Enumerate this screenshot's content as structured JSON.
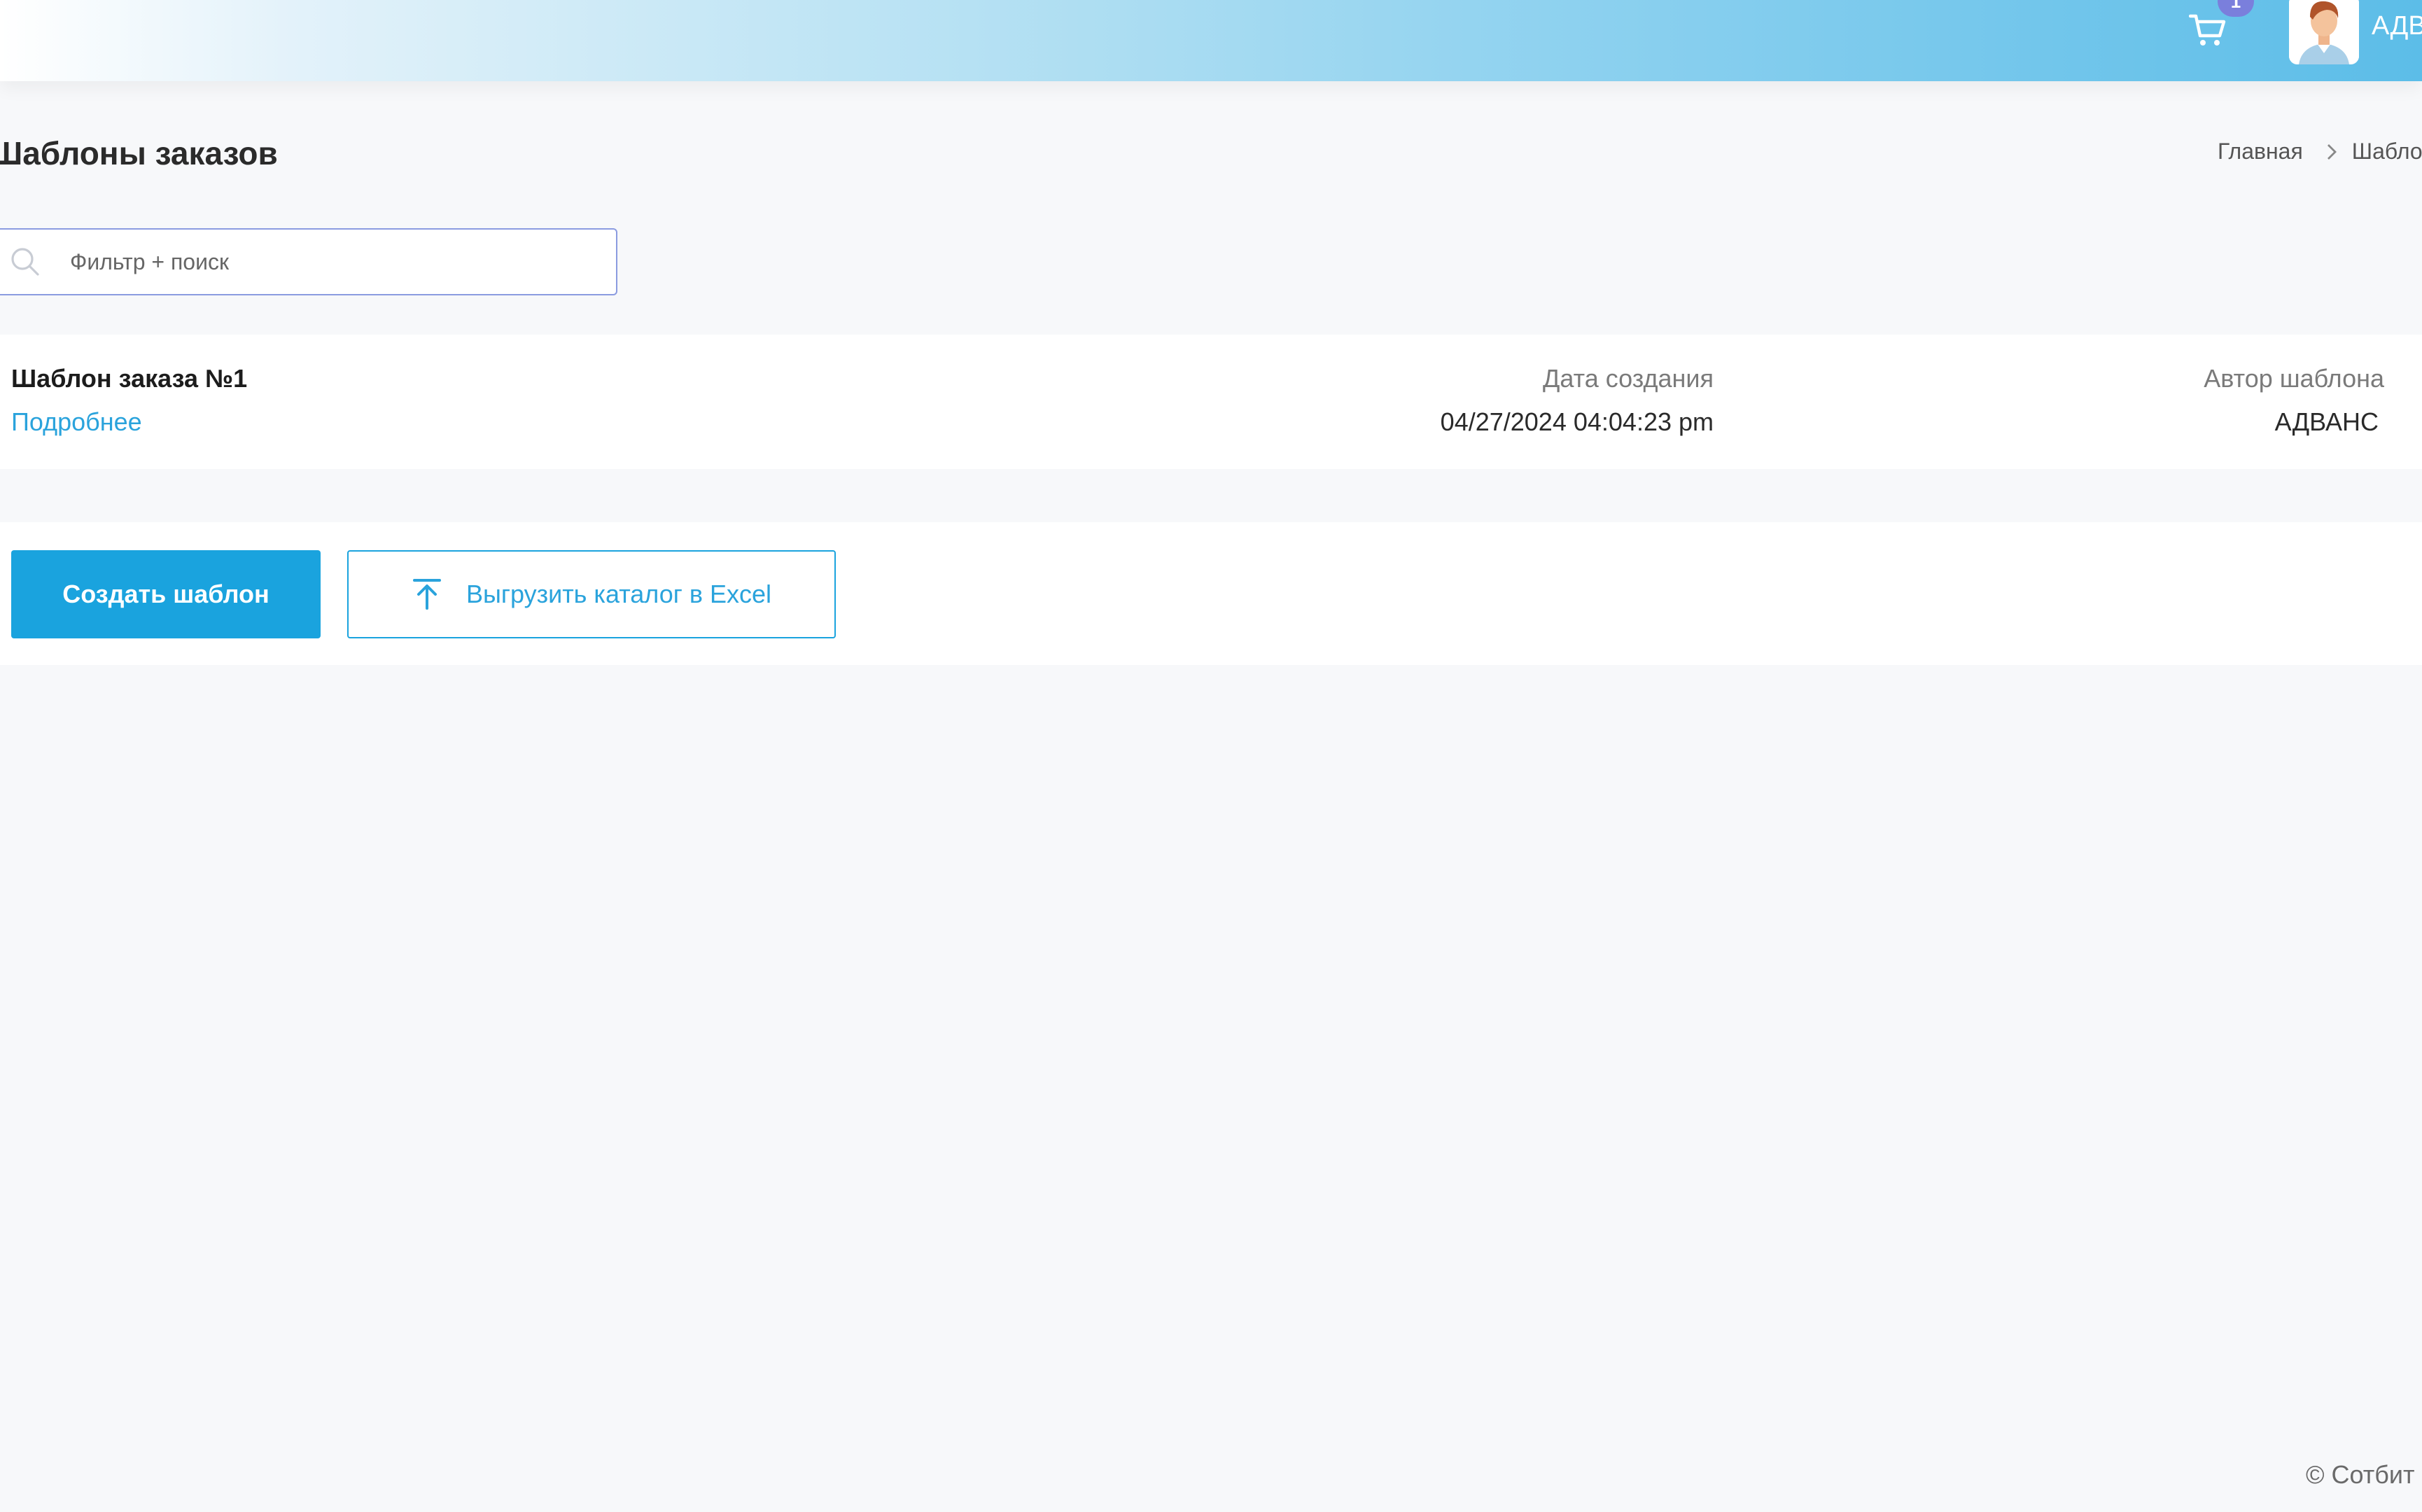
{
  "header": {
    "cart_badge": "1",
    "user_name": "АДВАНС"
  },
  "page": {
    "title": "Шаблоны заказов"
  },
  "breadcrumb": {
    "home": "Главная",
    "current": "Шаблоны заказов"
  },
  "search": {
    "placeholder": "Фильтр + поиск"
  },
  "templates": [
    {
      "name": "Шаблон заказа №1",
      "link": "Подробнее",
      "date_label": "Дата создания",
      "date_value": "04/27/2024 04:04:23 pm",
      "author_label": "Автор шаблона",
      "author_value": "АДВАНС"
    }
  ],
  "actions": {
    "create_label": "Создать шаблон",
    "export_label": "Выгрузить каталог в Excel"
  },
  "footer": {
    "copyright": "© Сотбит"
  },
  "colors": {
    "accent": "#1aa3de",
    "badge": "#7a7fdc"
  }
}
